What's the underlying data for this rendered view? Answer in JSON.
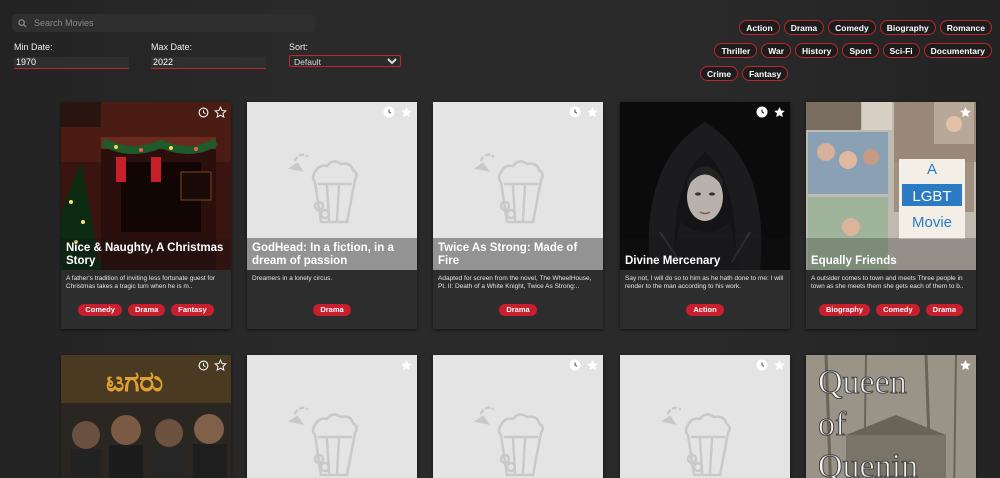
{
  "search": {
    "placeholder": "Search Movies"
  },
  "filters": {
    "min_date": {
      "label": "Min Date:",
      "value": "1970"
    },
    "max_date": {
      "label": "Max Date:",
      "value": "2022"
    },
    "sort": {
      "label": "Sort:",
      "value": "Default"
    }
  },
  "genres": [
    "Action",
    "Drama",
    "Comedy",
    "Biography",
    "Romance",
    "Thriller",
    "War",
    "History",
    "Sport",
    "Sci-Fi",
    "Documentary",
    "Crime",
    "Fantasy"
  ],
  "colors": {
    "accent": "#c71f2d",
    "background": "#2a2a2a",
    "card": "#2d2d2d",
    "placeholder": "#e4e4e4"
  },
  "movies": [
    {
      "title": "Nice & Naughty, A Christmas Story",
      "description": "A father's tradition of inviting less fortunate guest for Christmas takes a tragic turn when he is m..",
      "tags": [
        "Comedy",
        "Drama",
        "Fantasy"
      ],
      "poster": "christmas-fireplace-poster"
    },
    {
      "title": "GodHead: In a fiction, in a dream of passion",
      "description": "Dreamers in a lonely circus.",
      "tags": [
        "Drama"
      ],
      "poster": "popcorn-placeholder-icon"
    },
    {
      "title": "Twice As Strong: Made of Fire",
      "description": "Adapted for screen from the novel, The WheelHouse, Pt. II: Death of a White Knight, Twice As Strong:..",
      "tags": [
        "Drama"
      ],
      "poster": "popcorn-placeholder-icon"
    },
    {
      "title": "Divine Mercenary",
      "description": "Say not, I will do so to him as he hath done to me: I will render to the man according to his work.",
      "tags": [
        "Action"
      ],
      "poster": "hooded-woman-poster"
    },
    {
      "title": "Equally Friends",
      "description": "A outsider comes to town and meets Three people in town as she meets them she gets each of them to b..",
      "tags": [
        "Biography",
        "Comedy",
        "Drama"
      ],
      "poster": "collage-poster",
      "poster_text": "A LGBT Movie"
    },
    {
      "poster": "tagaru-poster"
    },
    {
      "poster": "popcorn-placeholder-icon"
    },
    {
      "poster": "popcorn-placeholder-icon"
    },
    {
      "poster": "popcorn-placeholder-icon"
    },
    {
      "poster": "queen-of-quenin-poster",
      "poster_text": "Queen of Quenin"
    }
  ]
}
